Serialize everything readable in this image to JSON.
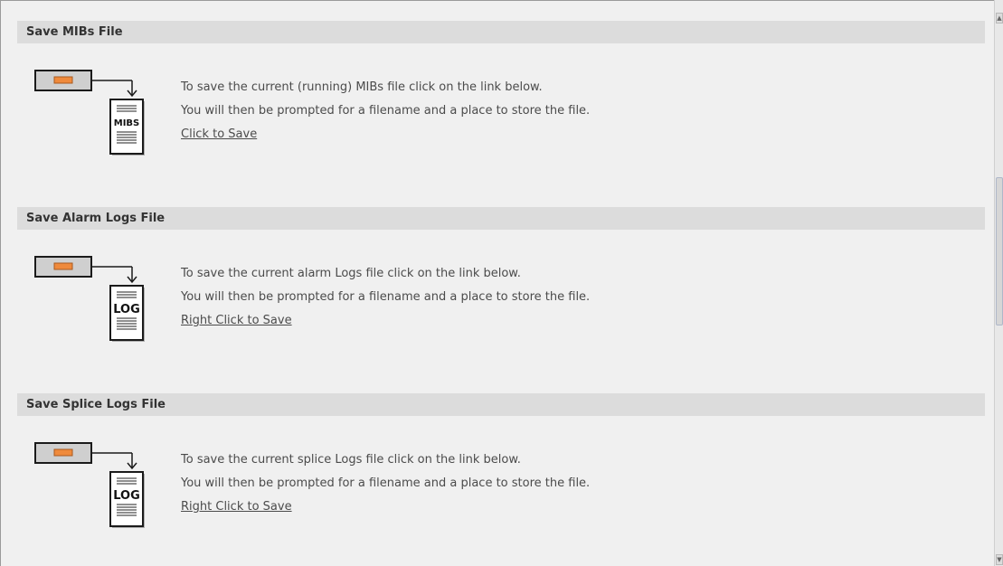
{
  "sections": [
    {
      "title": "Save MIBs File",
      "icon_label": "MIBS",
      "line1": "To save the current (running) MIBs file click on the link below.",
      "line2": "You will then be prompted for a filename and a place to store the file.",
      "link": "Click to Save"
    },
    {
      "title": "Save Alarm Logs File",
      "icon_label": "LOG",
      "line1": "To save the current alarm Logs file click on the link below.",
      "line2": "You will then be prompted for a filename and a place to store the file.",
      "link": "Right Click to Save"
    },
    {
      "title": "Save Splice Logs File",
      "icon_label": "LOG",
      "line1": "To save the current splice Logs file click on the link below.",
      "line2": "You will then be prompted for a filename and a place to store the file.",
      "link": "Right Click to Save"
    }
  ],
  "colors": {
    "header_bg": "#dcdcdc",
    "page_bg": "#f0f0f0",
    "device_light": "#ef8a3c",
    "text": "#4b4b4b"
  },
  "icons": {
    "device": "device-icon",
    "document": "document-icon",
    "arrow": "arrow-down-icon"
  }
}
